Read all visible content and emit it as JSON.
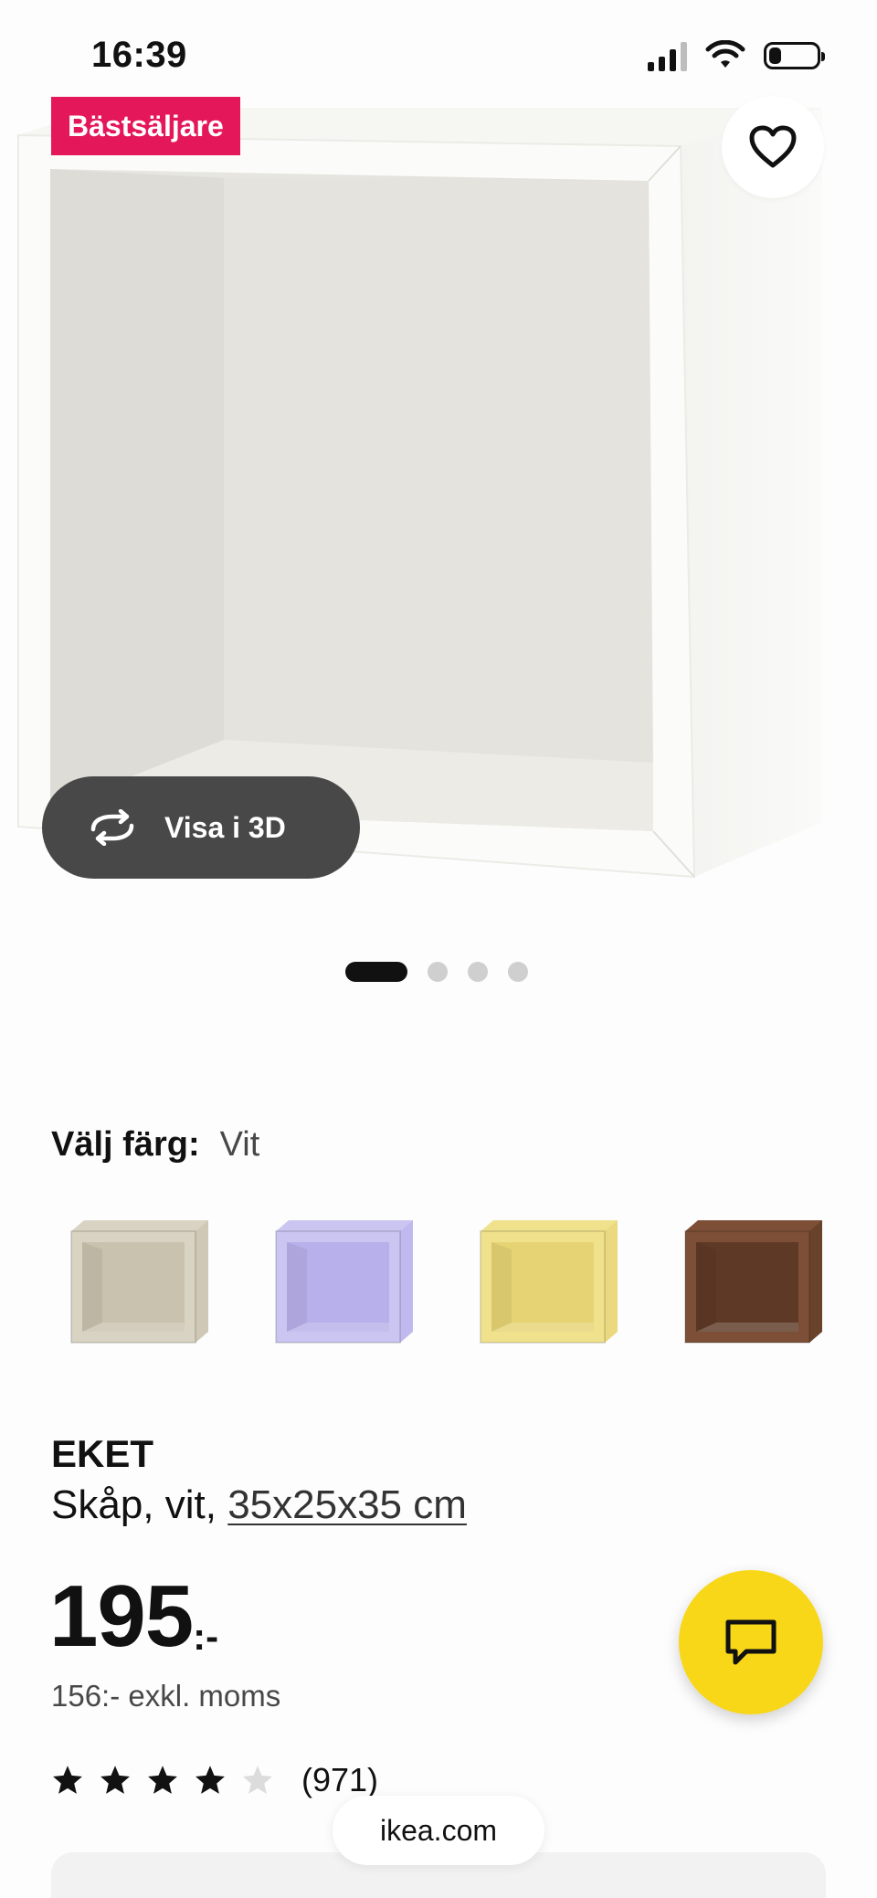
{
  "status_bar": {
    "time": "16:39",
    "battery_level": 0.25,
    "signal_bars_active": 3
  },
  "hero": {
    "badge": "Bästsäljare",
    "favorite_icon": "heart-icon",
    "view3d_label": "Visa i 3D",
    "view3d_icon": "rotate-icon",
    "image_count": 4,
    "active_image": 1
  },
  "color_picker": {
    "label": "Välj färg:",
    "selected": "Vit",
    "swatches": [
      {
        "color": "#d9d3c3",
        "inner": "#c9c2ae"
      },
      {
        "color": "#cbc5f2",
        "inner": "#b8b0ea"
      },
      {
        "color": "#f0e28c",
        "inner": "#e6d474"
      },
      {
        "color": "#7c4f36",
        "inner": "#5e3a26"
      }
    ]
  },
  "product": {
    "name": "EKET",
    "description": "Skåp, vit,",
    "size": "35x25x35 cm",
    "price": "195",
    "price_suffix": ":-",
    "price_excl": "156:- exkl. moms",
    "rating": 4,
    "rating_max": 5,
    "rating_count": "(971)"
  },
  "chat_button_icon": "chat-icon",
  "browser": {
    "url": "ikea.com"
  },
  "colors": {
    "badge": "#e4175b",
    "chat": "#f8d718",
    "view3d": "#484848"
  }
}
